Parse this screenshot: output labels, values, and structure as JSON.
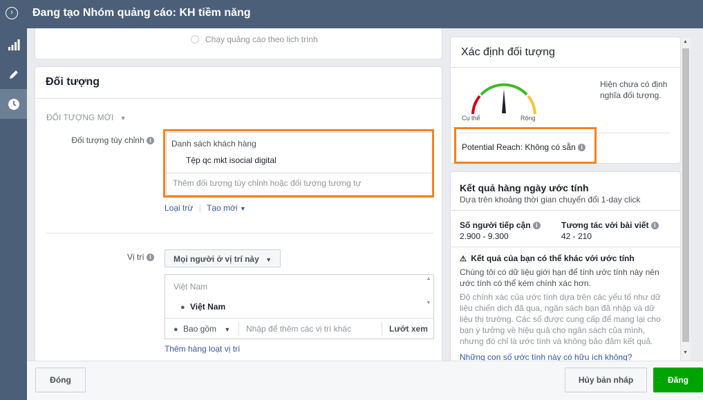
{
  "header": {
    "title": "Đang tạo Nhóm quảng cáo: KH tiềm năng"
  },
  "schedule_option": "Chạy quảng cáo theo lịch trình",
  "audience": {
    "section_title": "Đối tượng",
    "new_audience_label": "ĐỐI TƯỢNG MỚI",
    "custom_label": "Đối tượng tùy chỉnh",
    "list_header": "Danh sách khách hàng",
    "selected_audience": "Tệp qc mkt isocial digital",
    "add_placeholder": "Thêm đối tượng tùy chỉnh hoặc đối tượng tương tự",
    "exclude_link": "Loại trừ",
    "create_new_link": "Tạo mới"
  },
  "location": {
    "label": "Vị trí",
    "dropdown_value": "Mọi người ở vị trí này",
    "country_header": "Việt Nam",
    "selected_location": "Việt Nam",
    "include_label": "Bao gồm",
    "search_placeholder": "Nhập để thêm các vị trí khác",
    "browse_link": "Lướt xem",
    "bulk_add_link": "Thêm hàng loạt vị trí"
  },
  "definition": {
    "title": "Xác định đối tượng",
    "gauge_left": "Cụ thể",
    "gauge_right": "Rộng",
    "note": "Hiện chưa có định nghĩa đối tượng.",
    "potential_reach": "Potential Reach: Không có sẵn"
  },
  "estimates": {
    "title": "Kết quả hàng ngày ước tính",
    "subtitle": "Dựa trên khoảng thời gian chuyển đổi 1-day click",
    "reach_label": "Số người tiếp cận",
    "reach_value": "2.900 - 9.300",
    "engagement_label": "Tương tác với bài viết",
    "engagement_value": "42 - 210",
    "warning_title": "Kết quả của bạn có thể khác với ước tính",
    "warning_text": "Chúng tôi có dữ liệu giới hạn để tính ước tính này nên ước tính có thể kém chính xác hơn.",
    "accuracy_text": "Độ chính xác của ước tính dựa trên các yếu tố như dữ liệu chiến dịch đã qua, ngân sách bạn đã nhập và dữ liệu thị trường. Các số được cung cấp để mang lại cho bạn ý tưởng về hiệu quả cho ngân sách của mình, nhưng đó chỉ là ước tính và không bảo đảm kết quả.",
    "helpful_link": "Những con số ước tính này có hữu ích không?"
  },
  "footer": {
    "close_label": "Đóng",
    "discard_label": "Hủy bản nháp",
    "publish_label": "Đăng"
  },
  "colors": {
    "accent": "#f58220",
    "header": "#4b5f78",
    "publish": "#00a400",
    "link": "#365899"
  }
}
